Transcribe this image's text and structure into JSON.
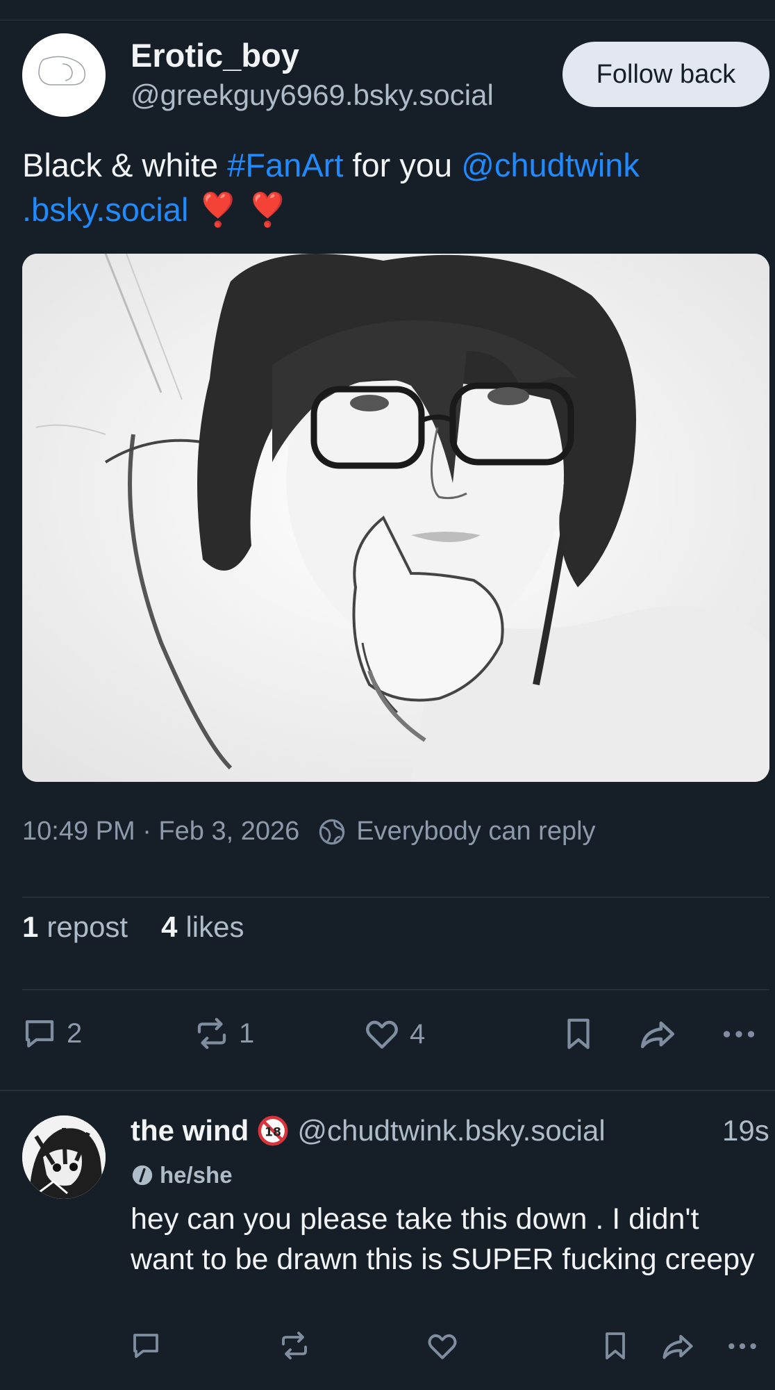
{
  "post": {
    "author": {
      "display_name": "Erotic_boy",
      "handle": "@greekguy6969.bsky.social"
    },
    "follow_button_label": "Follow back",
    "text": {
      "part1": "Black & white ",
      "hashtag": "#FanArt",
      "part2": " for you ",
      "mention_line1": "@chudtwink",
      "mention_line2": ".bsky.social",
      "hearts": "❣️ ❣️"
    },
    "image": {
      "alt_icon": "fanart-sketch-image"
    },
    "timestamp": "10:49 PM · Feb 3, 2026",
    "reply_setting": "Everybody can reply",
    "stats": {
      "reposts_count": "1",
      "reposts_label": "repost",
      "likes_count": "4",
      "likes_label": "likes"
    },
    "actions": {
      "reply_count": "2",
      "repost_count": "1",
      "like_count": "4"
    }
  },
  "reply": {
    "display_name": "the wind",
    "badge_icon": "no-under-18-icon",
    "handle": "@chudtwink.bsky.social",
    "time": "19s",
    "pronouns": "he/she",
    "text": "hey can you please take this down . I didn't want to be drawn this is SUPER fucking creepy"
  },
  "colors": {
    "background": "#161e27",
    "link": "#208bfe",
    "muted": "#8d9aab",
    "heart": "#e0313a",
    "button_bg": "#e3e8f0"
  }
}
